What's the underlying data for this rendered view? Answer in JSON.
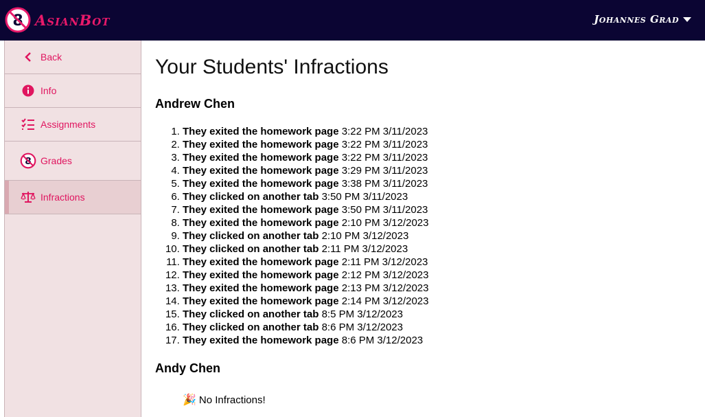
{
  "app": {
    "name": "AsianBot"
  },
  "header": {
    "user_name": "Johannes Grad"
  },
  "sidebar": {
    "items": [
      {
        "label": "Back",
        "icon": "chevron-left-icon"
      },
      {
        "label": "Info",
        "icon": "info-icon"
      },
      {
        "label": "Assignments",
        "icon": "checklist-icon"
      },
      {
        "label": "Grades",
        "icon": "asianbot-logo-icon"
      },
      {
        "label": "Infractions",
        "icon": "scale-icon"
      }
    ],
    "active": "Infractions"
  },
  "colors": {
    "accent": "#e0155f",
    "topbar": "#0b0533",
    "sidebar_bg": "#f1e1e3"
  },
  "main": {
    "title": "Your Students' Infractions",
    "students": [
      {
        "name": "Andrew Chen",
        "infractions": [
          {
            "action": "They exited the homework page",
            "time": "3:22 PM 3/11/2023"
          },
          {
            "action": "They exited the homework page",
            "time": "3:22 PM 3/11/2023"
          },
          {
            "action": "They exited the homework page",
            "time": "3:22 PM 3/11/2023"
          },
          {
            "action": "They exited the homework page",
            "time": "3:29 PM 3/11/2023"
          },
          {
            "action": "They exited the homework page",
            "time": "3:38 PM 3/11/2023"
          },
          {
            "action": "They clicked on another tab",
            "time": "3:50 PM 3/11/2023"
          },
          {
            "action": "They exited the homework page",
            "time": "3:50 PM 3/11/2023"
          },
          {
            "action": "They exited the homework page",
            "time": "2:10 PM 3/12/2023"
          },
          {
            "action": "They clicked on another tab",
            "time": "2:10 PM 3/12/2023"
          },
          {
            "action": "They clicked on another tab",
            "time": "2:11 PM 3/12/2023"
          },
          {
            "action": "They exited the homework page",
            "time": "2:11 PM 3/12/2023"
          },
          {
            "action": "They exited the homework page",
            "time": "2:12 PM 3/12/2023"
          },
          {
            "action": "They exited the homework page",
            "time": "2:13 PM 3/12/2023"
          },
          {
            "action": "They exited the homework page",
            "time": "2:14 PM 3/12/2023"
          },
          {
            "action": "They clicked on another tab",
            "time": "8:5 PM 3/12/2023"
          },
          {
            "action": "They clicked on another tab",
            "time": "8:6 PM 3/12/2023"
          },
          {
            "action": "They exited the homework page",
            "time": "8:6 PM 3/12/2023"
          }
        ]
      },
      {
        "name": "Andy Chen",
        "no_infractions_text": "No Infractions!",
        "no_infractions_icon": "party-popper-icon"
      }
    ]
  }
}
